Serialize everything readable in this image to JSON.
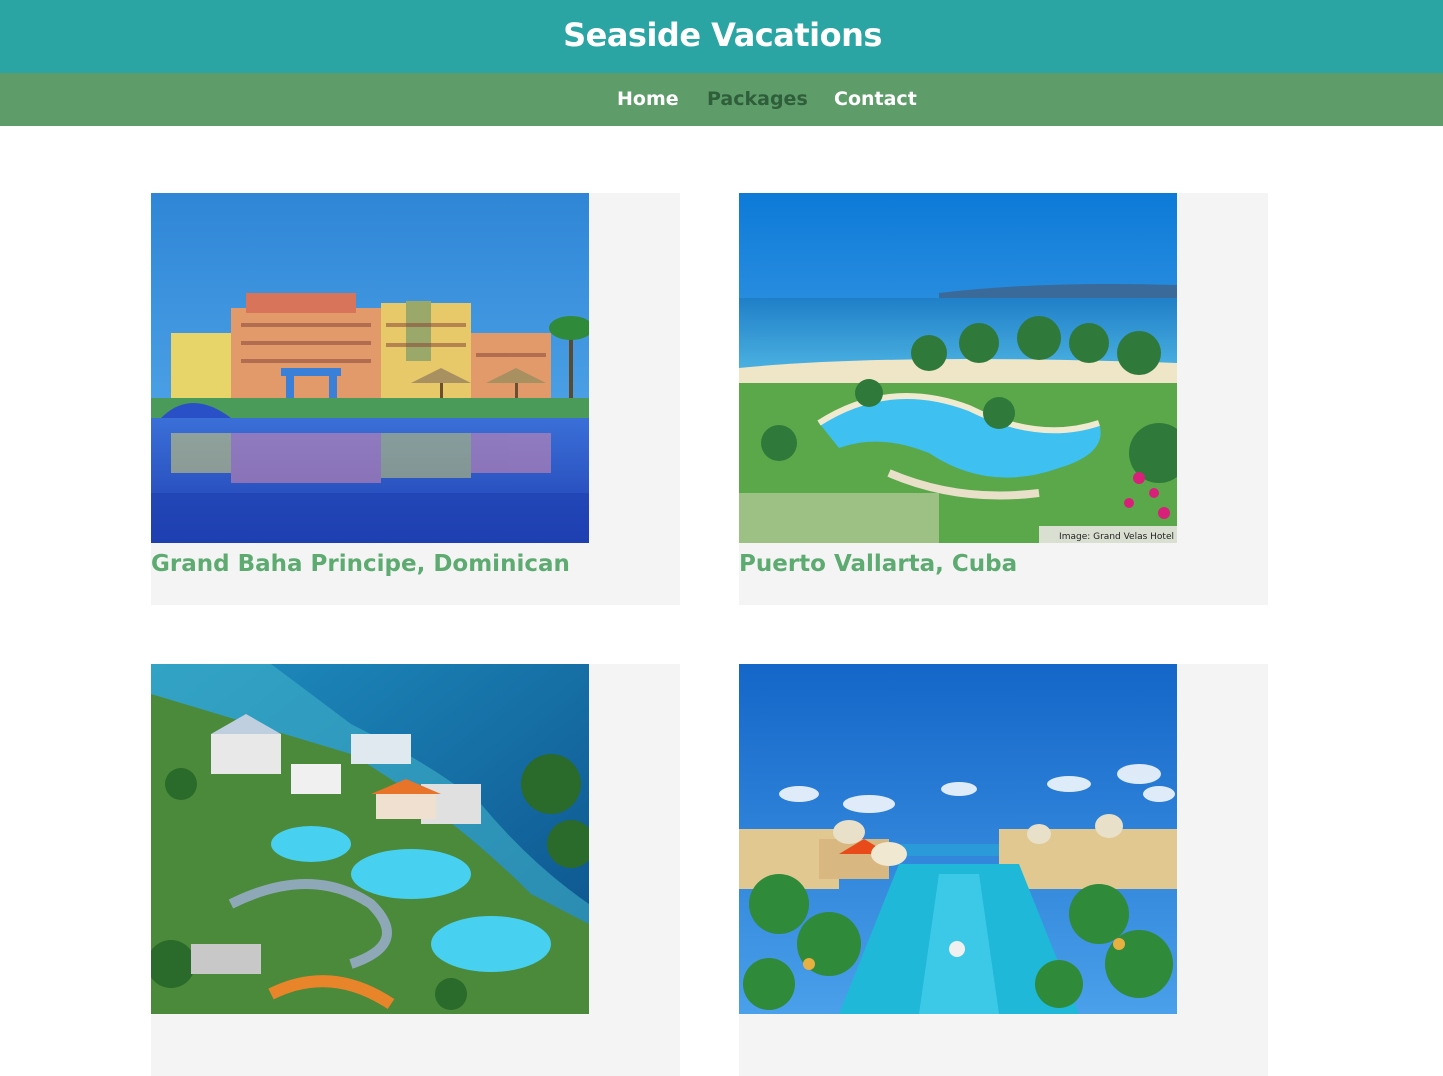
{
  "site": {
    "title": "Seaside Vacations"
  },
  "nav": {
    "items": [
      {
        "label": "Home",
        "active": false
      },
      {
        "label": "Packages",
        "active": true
      },
      {
        "label": "Contact",
        "active": false
      }
    ]
  },
  "packages": [
    {
      "name": "Grand Baha Principe, Dominican",
      "image": "resort-pool-photo"
    },
    {
      "name": "Puerto Vallarta, Cuba",
      "image": "beach-resort-aerial-photo",
      "image_credit": "Image: Grand Velas Hotel"
    },
    {
      "name": "",
      "image": "waterpark-resort-aerial-photo"
    },
    {
      "name": "",
      "image": "palace-resort-pool-photo"
    }
  ],
  "colors": {
    "header_bg": "#2ba4a4",
    "nav_bg": "#5e9d6a",
    "nav_active": "#2f5e3a",
    "card_bg": "#f4f4f4",
    "card_title": "#5eab72"
  }
}
